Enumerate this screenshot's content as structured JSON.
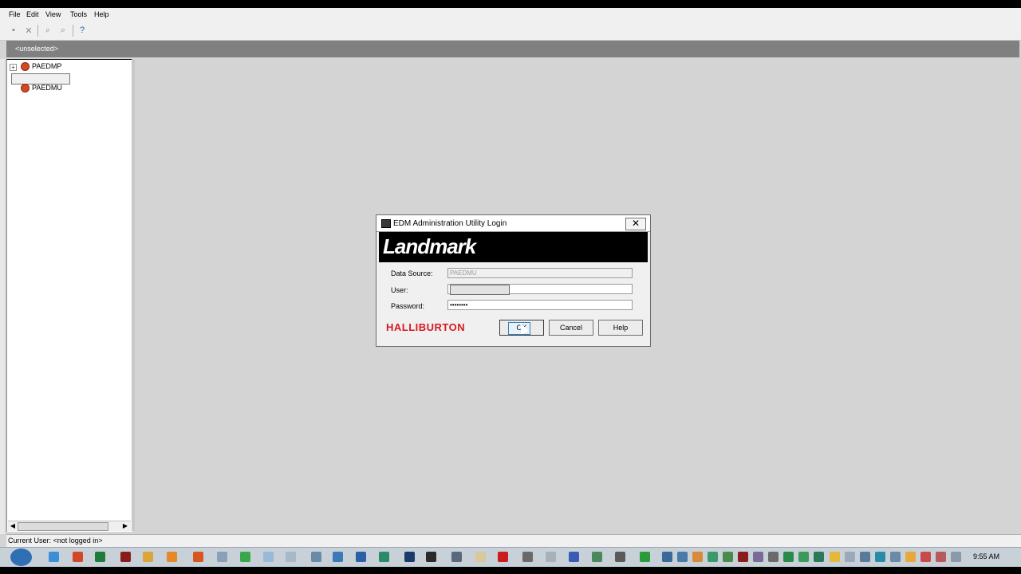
{
  "menu": {
    "file": "File",
    "edit": "Edit",
    "view": "View",
    "tools": "Tools",
    "help": "Help"
  },
  "selection_bar": {
    "text": "<unselected>"
  },
  "tree": {
    "items": [
      {
        "label": "PAEDMP"
      },
      {
        "label": "PAEDMU"
      }
    ]
  },
  "status": {
    "text": "Current User: <not logged in>"
  },
  "dialog": {
    "title": "EDM Administration Utility Login",
    "banner": "Landmark",
    "data_source_label": "Data Source:",
    "data_source_value": "PAEDMU",
    "user_label": "User:",
    "user_value": "",
    "password_label": "Password:",
    "password_value": "********",
    "brand": "HALLIBURTON",
    "ok_label": "OK",
    "cancel_label": "Cancel",
    "help_label": "Help",
    "close_glyph": "✕"
  },
  "taskbar": {
    "clock": "9:55 AM"
  },
  "colors": {
    "brand_red": "#d71920",
    "selection_bar": "#808080",
    "workspace": "#d4d4d4"
  }
}
